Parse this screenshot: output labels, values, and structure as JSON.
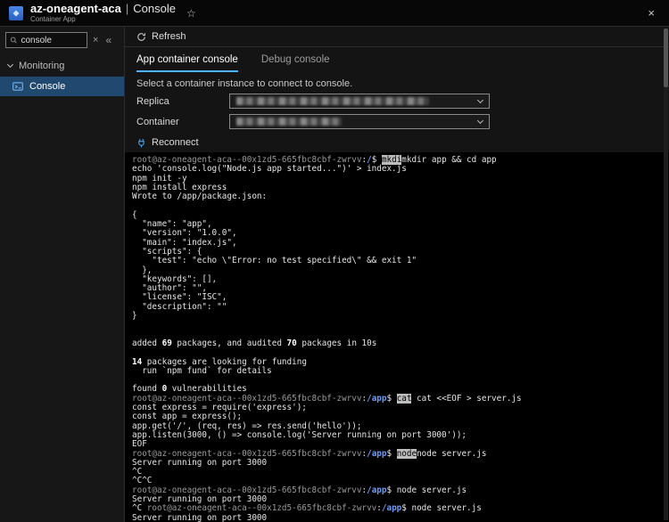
{
  "colors": {
    "accent": "#4db2ff",
    "selected_nav_bg": "#21486f",
    "terminal_bg": "#000000",
    "prompt_host": "#9a9a9a",
    "prompt_path": "#6e9bf7",
    "selection_bg": "#bdbdbd"
  },
  "header": {
    "app_name": "az-oneagent-aca",
    "separator": "|",
    "page_title": "Console",
    "subtitle": "Container App",
    "star_icon": "☆",
    "close_icon": "×"
  },
  "sidebar": {
    "search": {
      "value": "console"
    },
    "clear_icon": "×",
    "collapse_icon": "«",
    "section_label": "Monitoring",
    "items": [
      {
        "label": "Console",
        "selected": true
      }
    ]
  },
  "toolbar": {
    "refresh_label": "Refresh"
  },
  "tabs": [
    {
      "label": "App container console",
      "active": true
    },
    {
      "label": "Debug console",
      "active": false
    }
  ],
  "form": {
    "instruction": "Select a container instance to connect to console.",
    "replica_label": "Replica",
    "container_label": "Container"
  },
  "actions": {
    "reconnect_label": "Reconnect"
  },
  "terminal": {
    "lines": [
      [
        {
          "t": "root@az-oneagent-aca--00x1zd5-665fbc8cbf-zwrvv",
          "s": "d"
        },
        {
          "t": ":",
          "s": "p"
        },
        {
          "t": "/",
          "s": "b"
        },
        {
          "t": "$ ",
          "s": "p"
        },
        {
          "t": "mkdi",
          "s": "h"
        },
        {
          "t": "mkdir app && cd app",
          "s": "p"
        }
      ],
      [
        {
          "t": "echo 'console.log(\"Node.js app started...\")' > index.js",
          "s": "p"
        }
      ],
      [
        {
          "t": "npm init -y",
          "s": "p"
        }
      ],
      [
        {
          "t": "npm install express",
          "s": "p"
        }
      ],
      [
        {
          "t": "Wrote to /app/package.json:",
          "s": "p"
        }
      ],
      [],
      [
        {
          "t": "{",
          "s": "p"
        }
      ],
      [
        {
          "t": "  \"name\": \"app\",",
          "s": "p"
        }
      ],
      [
        {
          "t": "  \"version\": \"1.0.0\",",
          "s": "p"
        }
      ],
      [
        {
          "t": "  \"main\": \"index.js\",",
          "s": "p"
        }
      ],
      [
        {
          "t": "  \"scripts\": {",
          "s": "p"
        }
      ],
      [
        {
          "t": "    \"test\": \"echo \\\"Error: no test specified\\\" && exit 1\"",
          "s": "p"
        }
      ],
      [
        {
          "t": "  },",
          "s": "p"
        }
      ],
      [
        {
          "t": "  \"keywords\": [],",
          "s": "p"
        }
      ],
      [
        {
          "t": "  \"author\": \"\",",
          "s": "p"
        }
      ],
      [
        {
          "t": "  \"license\": \"ISC\",",
          "s": "p"
        }
      ],
      [
        {
          "t": "  \"description\": \"\"",
          "s": "p"
        }
      ],
      [
        {
          "t": "}",
          "s": "p"
        }
      ],
      [],
      [],
      [
        {
          "t": "added ",
          "s": "p"
        },
        {
          "t": "69",
          "s": "s"
        },
        {
          "t": " packages, and audited ",
          "s": "p"
        },
        {
          "t": "70",
          "s": "s"
        },
        {
          "t": " packages in 10s",
          "s": "p"
        }
      ],
      [],
      [
        {
          "t": "14",
          "s": "s"
        },
        {
          "t": " packages are looking for funding",
          "s": "p"
        }
      ],
      [
        {
          "t": "  run `npm fund` for details",
          "s": "p"
        }
      ],
      [],
      [
        {
          "t": "found ",
          "s": "p"
        },
        {
          "t": "0",
          "s": "s"
        },
        {
          "t": " vulnerabilities",
          "s": "p"
        }
      ],
      [
        {
          "t": "root@az-oneagent-aca--00x1zd5-665fbc8cbf-zwrvv",
          "s": "d"
        },
        {
          "t": ":",
          "s": "p"
        },
        {
          "t": "/app",
          "s": "b"
        },
        {
          "t": "$ ",
          "s": "p"
        },
        {
          "t": "cat",
          "s": "h"
        },
        {
          "t": " cat <<EOF > server.js",
          "s": "p"
        }
      ],
      [
        {
          "t": "const express = require('express');",
          "s": "p"
        }
      ],
      [
        {
          "t": "const app = express();",
          "s": "p"
        }
      ],
      [
        {
          "t": "app.get('/', (req, res) => res.send('hello'));",
          "s": "p"
        }
      ],
      [
        {
          "t": "app.listen(3000, () => console.log('Server running on port 3000'));",
          "s": "p"
        }
      ],
      [
        {
          "t": "EOF",
          "s": "p"
        }
      ],
      [
        {
          "t": "root@az-oneagent-aca--00x1zd5-665fbc8cbf-zwrvv",
          "s": "d"
        },
        {
          "t": ":",
          "s": "p"
        },
        {
          "t": "/app",
          "s": "b"
        },
        {
          "t": "$ ",
          "s": "p"
        },
        {
          "t": "node",
          "s": "h"
        },
        {
          "t": "node server.js",
          "s": "p"
        }
      ],
      [
        {
          "t": "Server running on port 3000",
          "s": "p"
        }
      ],
      [
        {
          "t": "^C",
          "s": "p"
        }
      ],
      [
        {
          "t": "^C^C",
          "s": "p"
        }
      ],
      [
        {
          "t": "root@az-oneagent-aca--00x1zd5-665fbc8cbf-zwrvv",
          "s": "d"
        },
        {
          "t": ":",
          "s": "p"
        },
        {
          "t": "/app",
          "s": "b"
        },
        {
          "t": "$ ",
          "s": "p"
        },
        {
          "t": "node server.js",
          "s": "p"
        }
      ],
      [
        {
          "t": "Server running on port 3000",
          "s": "p"
        }
      ],
      [
        {
          "t": "^C ",
          "s": "p"
        },
        {
          "t": "root@az-oneagent-aca--00x1zd5-665fbc8cbf-zwrvv",
          "s": "d"
        },
        {
          "t": ":",
          "s": "p"
        },
        {
          "t": "/app",
          "s": "b"
        },
        {
          "t": "$ ",
          "s": "p"
        },
        {
          "t": "node server.js",
          "s": "p"
        }
      ],
      [
        {
          "t": "Server running on port 3000",
          "s": "p"
        }
      ]
    ]
  }
}
